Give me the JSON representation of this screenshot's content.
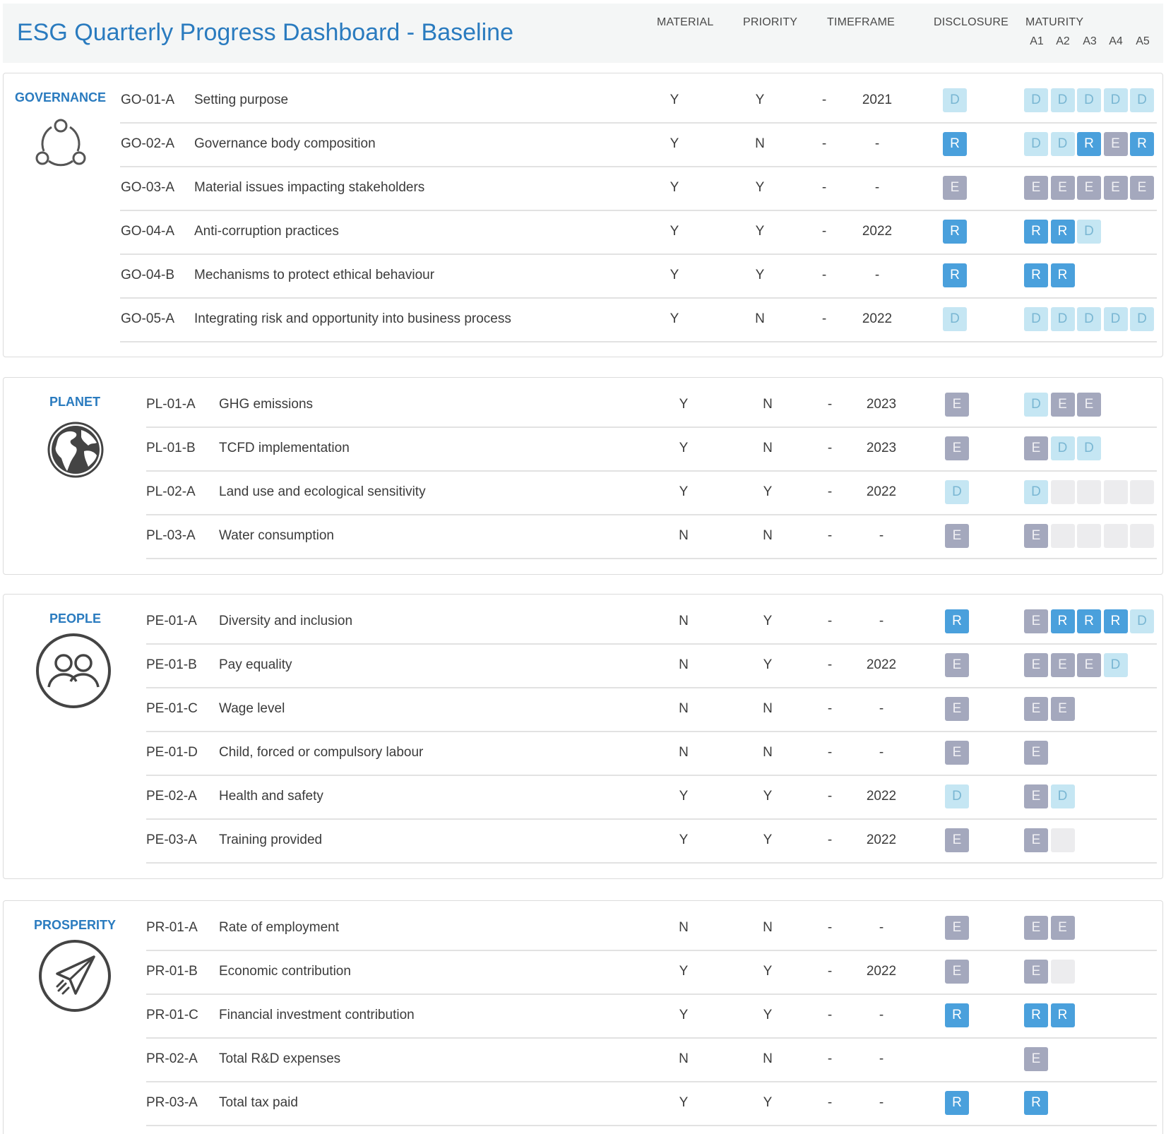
{
  "title": "ESG Quarterly Progress Dashboard - Baseline",
  "columns": {
    "material": "MATERIAL",
    "priority": "PRIORITY",
    "timeframe": "TIMEFRAME",
    "disclosure": "DISCLOSURE",
    "maturity": "MATURITY",
    "maturity_levels": [
      "A1",
      "A2",
      "A3",
      "A4",
      "A5"
    ]
  },
  "colors": {
    "D": "#c5e6f3",
    "R": "#4aa0dc",
    "E": "#a4a8bd",
    "empty": "#ececee",
    "accent": "#2a7bbf"
  },
  "sections": [
    {
      "label": "GOVERNANCE",
      "icon": "governance-network-icon",
      "rows": [
        {
          "code": "GO-01-A",
          "name": "Setting purpose",
          "material": "Y",
          "priority": "Y",
          "dash": "-",
          "year": "2021",
          "disclosure": "D",
          "maturity": [
            "D",
            "D",
            "D",
            "D",
            "D"
          ]
        },
        {
          "code": "GO-02-A",
          "name": "Governance body composition",
          "material": "Y",
          "priority": "N",
          "dash": "-",
          "year": "-",
          "disclosure": "R",
          "maturity": [
            "D",
            "D",
            "R",
            "E",
            "R"
          ]
        },
        {
          "code": "GO-03-A",
          "name": "Material issues impacting stakeholders",
          "material": "Y",
          "priority": "Y",
          "dash": "-",
          "year": "-",
          "disclosure": "E",
          "maturity": [
            "E",
            "E",
            "E",
            "E",
            "E"
          ]
        },
        {
          "code": "GO-04-A",
          "name": "Anti-corruption practices",
          "material": "Y",
          "priority": "Y",
          "dash": "-",
          "year": "2022",
          "disclosure": "R",
          "maturity": [
            "R",
            "R",
            "D"
          ]
        },
        {
          "code": "GO-04-B",
          "name": "Mechanisms to protect ethical behaviour",
          "material": "Y",
          "priority": "Y",
          "dash": "-",
          "year": "-",
          "disclosure": "R",
          "maturity": [
            "R",
            "R"
          ]
        },
        {
          "code": "GO-05-A",
          "name": "Integrating risk and opportunity into business process",
          "material": "Y",
          "priority": "N",
          "dash": "-",
          "year": "2022",
          "disclosure": "D",
          "maturity": [
            "D",
            "D",
            "D",
            "D",
            "D"
          ]
        }
      ]
    },
    {
      "label": "PLANET",
      "icon": "globe-icon",
      "rows": [
        {
          "code": "PL-01-A",
          "name": "GHG emissions",
          "material": "Y",
          "priority": "N",
          "dash": "-",
          "year": "2023",
          "disclosure": "E",
          "maturity": [
            "D",
            "E",
            "E"
          ]
        },
        {
          "code": "PL-01-B",
          "name": "TCFD implementation",
          "material": "Y",
          "priority": "N",
          "dash": "-",
          "year": "2023",
          "disclosure": "E",
          "maturity": [
            "E",
            "D",
            "D"
          ]
        },
        {
          "code": "PL-02-A",
          "name": "Land use and ecological sensitivity",
          "material": "Y",
          "priority": "Y",
          "dash": "-",
          "year": "2022",
          "disclosure": "D",
          "maturity": [
            "D",
            "",
            "",
            "",
            ""
          ]
        },
        {
          "code": "PL-03-A",
          "name": "Water consumption",
          "material": "N",
          "priority": "N",
          "dash": "-",
          "year": "-",
          "disclosure": "E",
          "maturity": [
            "E",
            "",
            "",
            "",
            ""
          ]
        }
      ]
    },
    {
      "label": "PEOPLE",
      "icon": "people-icon",
      "rows": [
        {
          "code": "PE-01-A",
          "name": "Diversity and inclusion",
          "material": "N",
          "priority": "Y",
          "dash": "-",
          "year": "-",
          "disclosure": "R",
          "maturity": [
            "E",
            "R",
            "R",
            "R",
            "D"
          ]
        },
        {
          "code": "PE-01-B",
          "name": "Pay equality",
          "material": "N",
          "priority": "Y",
          "dash": "-",
          "year": "2022",
          "disclosure": "E",
          "maturity": [
            "E",
            "E",
            "E",
            "D"
          ]
        },
        {
          "code": "PE-01-C",
          "name": "Wage level",
          "material": "N",
          "priority": "N",
          "dash": "-",
          "year": "-",
          "disclosure": "E",
          "maturity": [
            "E",
            "E"
          ]
        },
        {
          "code": "PE-01-D",
          "name": "Child, forced or compulsory labour",
          "material": "N",
          "priority": "N",
          "dash": "-",
          "year": "-",
          "disclosure": "E",
          "maturity": [
            "E"
          ]
        },
        {
          "code": "PE-02-A",
          "name": "Health and safety",
          "material": "Y",
          "priority": "Y",
          "dash": "-",
          "year": "2022",
          "disclosure": "D",
          "maturity": [
            "E",
            "D"
          ]
        },
        {
          "code": "PE-03-A",
          "name": "Training provided",
          "material": "Y",
          "priority": "Y",
          "dash": "-",
          "year": "2022",
          "disclosure": "E",
          "maturity": [
            "E",
            ""
          ]
        }
      ]
    },
    {
      "label": "PROSPERITY",
      "icon": "paper-plane-icon",
      "rows": [
        {
          "code": "PR-01-A",
          "name": "Rate of employment",
          "material": "N",
          "priority": "N",
          "dash": "-",
          "year": "-",
          "disclosure": "E",
          "maturity": [
            "E",
            "E"
          ]
        },
        {
          "code": "PR-01-B",
          "name": "Economic contribution",
          "material": "Y",
          "priority": "Y",
          "dash": "-",
          "year": "2022",
          "disclosure": "E",
          "maturity": [
            "E",
            ""
          ]
        },
        {
          "code": "PR-01-C",
          "name": "Financial investment contribution",
          "material": "Y",
          "priority": "Y",
          "dash": "-",
          "year": "-",
          "disclosure": "R",
          "maturity": [
            "R",
            "R"
          ]
        },
        {
          "code": "PR-02-A",
          "name": "Total R&D expenses",
          "material": "N",
          "priority": "N",
          "dash": "-",
          "year": "-",
          "disclosure": "",
          "maturity": [
            "E"
          ]
        },
        {
          "code": "PR-03-A",
          "name": "Total tax paid",
          "material": "Y",
          "priority": "Y",
          "dash": "-",
          "year": "-",
          "disclosure": "R",
          "maturity": [
            "R"
          ]
        }
      ]
    }
  ]
}
